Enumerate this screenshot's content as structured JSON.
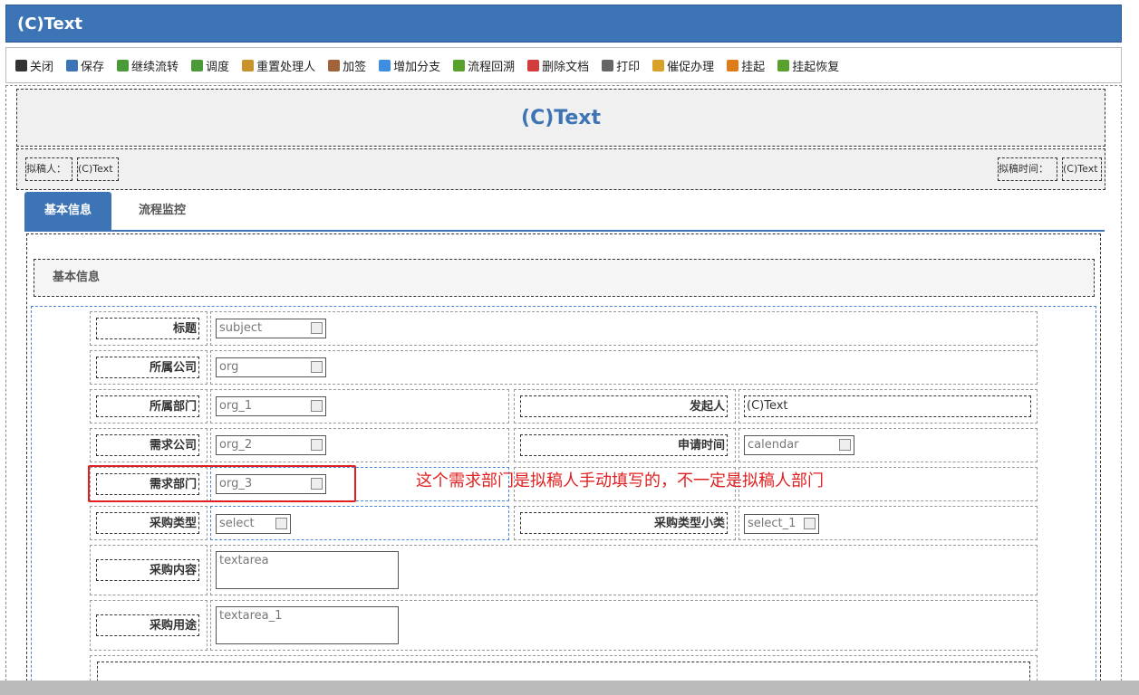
{
  "window_title": "(C)Text",
  "toolbar": [
    "关闭",
    "保存",
    "继续流转",
    "调度",
    "重置处理人",
    "加签",
    "增加分支",
    "流程回溯",
    "删除文档",
    "打印",
    "催促办理",
    "挂起",
    "挂起恢复"
  ],
  "toolbar_colors": [
    "#333",
    "#3d74b5",
    "#4a9a3a",
    "#4a9a3a",
    "#c8932b",
    "#a0633a",
    "#3d8ee0",
    "#5aa02c",
    "#d23c3c",
    "#666",
    "#d8a22a",
    "#e07b1a",
    "#5aa02c"
  ],
  "form_title": "(C)Text",
  "drafter_label": "拟稿人：",
  "drafter_value": "(C)Text",
  "draft_time_label": "拟稿时间：",
  "draft_time_value": "(C)Text",
  "tabs": [
    "基本信息",
    "流程监控"
  ],
  "section_title": "基本信息",
  "fields": {
    "subject": {
      "label": "标题",
      "value": "subject"
    },
    "company": {
      "label": "所属公司",
      "value": "org"
    },
    "dept": {
      "label": "所属部门",
      "value": "org_1"
    },
    "initiator": {
      "label": "发起人",
      "value": "(C)Text"
    },
    "req_company": {
      "label": "需求公司",
      "value": "org_2"
    },
    "apply_time": {
      "label": "申请时间",
      "value": "calendar"
    },
    "req_dept": {
      "label": "需求部门",
      "value": "org_3"
    },
    "purchase_type": {
      "label": "采购类型",
      "value": "select"
    },
    "purchase_subtype": {
      "label": "采购类型小类",
      "value": "select_1"
    },
    "content": {
      "label": "采购内容",
      "value": "textarea"
    },
    "usage": {
      "label": "采购用途",
      "value": "textarea_1"
    }
  },
  "annotation": "这个需求部门是拟稿人手动填写的，不一定是拟稿人部门"
}
